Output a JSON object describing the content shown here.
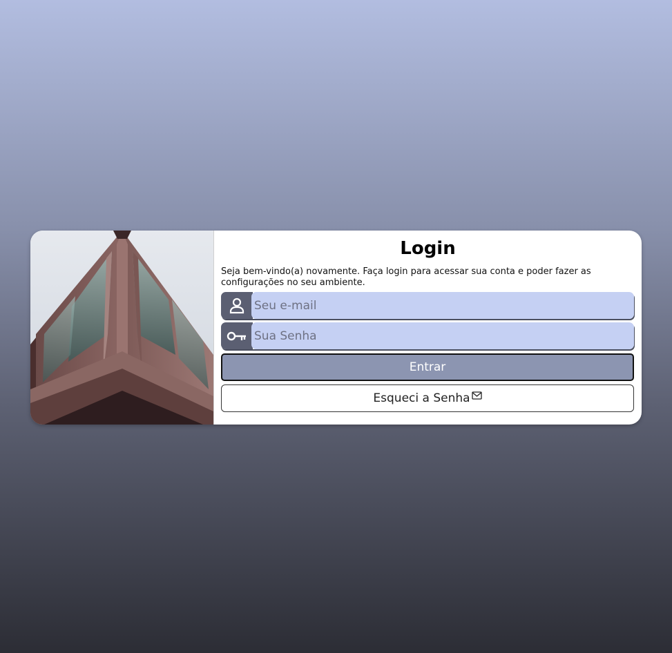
{
  "login": {
    "title": "Login",
    "subtitle": "Seja bem-vindo(a) novamente. Faça login para acessar sua conta e poder fazer as configurações no seu ambiente.",
    "email_placeholder": "Seu e-mail",
    "password_placeholder": "Sua Senha",
    "submit_label": "Entrar",
    "forgot_label": "Esqueci a Senha"
  },
  "icons": {
    "email": "user-icon",
    "password": "key-icon",
    "forgot": "mail-icon"
  },
  "colors": {
    "accent_dark": "#5b5f72",
    "input_bg": "#c5d0f3",
    "button_bg": "#8c95b1",
    "card_bg": "#ffffff"
  }
}
